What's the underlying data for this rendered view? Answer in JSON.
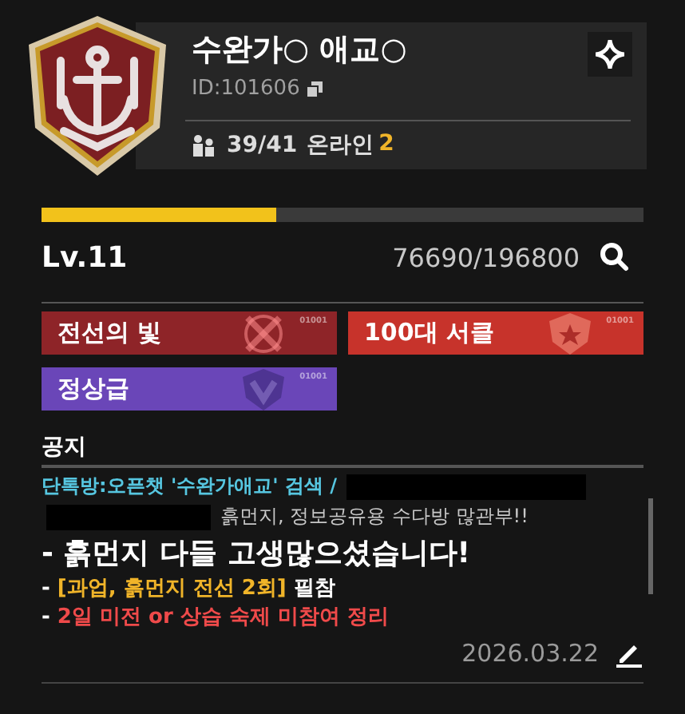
{
  "guild": {
    "name": "수완가○ 애교○",
    "id": "ID:101606",
    "members": "39/41",
    "online_label": "온라인",
    "online_count": "2"
  },
  "progress": {
    "level": 0.39,
    "lv": "Lv.11",
    "exp": "76690/196800"
  },
  "tags": [
    {
      "label": "전선의 빛",
      "code": "01001",
      "color": "#8e2428",
      "kind": "swords"
    },
    {
      "label": "100대 서클",
      "code": "01001",
      "color": "#c7332b",
      "kind": "shield"
    },
    {
      "label": "정상급",
      "code": "01001",
      "color": "#6a46b8",
      "kind": "chevron"
    }
  ],
  "notice": {
    "title": "공지",
    "lines": [
      {
        "kind": "small",
        "segments": [
          {
            "text": "단톡방:오픈챗 '수완가애교' 검색 /",
            "color": "#56c6e0"
          },
          {
            "kind": "redacted"
          }
        ]
      },
      {
        "kind": "small",
        "segments": [
          {
            "kind": "redacted"
          },
          {
            "text": "흙먼지, 정보공유용 수다방 많관부!!",
            "color": "#c8c8c8"
          }
        ]
      },
      {
        "kind": "large",
        "segments": [
          {
            "text": "- 흙먼지 다들 고생많으셨습니다!",
            "color": "#ffffff"
          }
        ]
      },
      {
        "kind": "medium",
        "segments": [
          {
            "text": "- ",
            "color": "#ffffff"
          },
          {
            "text": "[과업, 흙먼지 전선 2회]",
            "color": "#f0b429"
          },
          {
            "text": " 필참",
            "color": "#ffffff"
          }
        ]
      },
      {
        "kind": "medium",
        "segments": [
          {
            "text": "- ",
            "color": "#ffffff"
          },
          {
            "text": "2일 미전 or 상습 숙제 미참여 정리",
            "color": "#ef4a4a"
          }
        ]
      }
    ],
    "date": "2026.03.22"
  }
}
